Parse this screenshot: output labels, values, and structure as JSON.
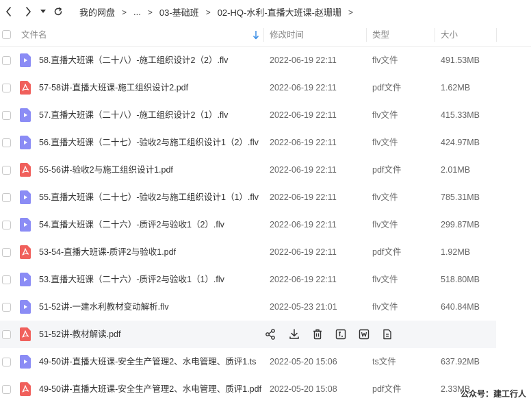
{
  "breadcrumb": {
    "items": [
      "我的网盘",
      "...",
      "03-基础班",
      "02-HQ-水利-直播大班课-赵珊珊"
    ],
    "separator": ">"
  },
  "columns": {
    "name": "文件名",
    "time": "修改时间",
    "type": "类型",
    "size": "大小"
  },
  "colors": {
    "video_icon": "#8b8cf5",
    "pdf_icon": "#f0605c",
    "sort_arrow": "#3a8ee6",
    "hover_row": "#f5f6f8"
  },
  "files": [
    {
      "icon": "video-file-icon",
      "name": "58.直播大班课（二十八）-施工组织设计2（2）.flv",
      "time": "2022-06-19 22:11",
      "type": "flv文件",
      "size": "491.53MB"
    },
    {
      "icon": "pdf-file-icon",
      "name": "57-58讲-直播大班课-施工组织设计2.pdf",
      "time": "2022-06-19 22:11",
      "type": "pdf文件",
      "size": "1.62MB"
    },
    {
      "icon": "video-file-icon",
      "name": "57.直播大班课（二十八）-施工组织设计2（1）.flv",
      "time": "2022-06-19 22:11",
      "type": "flv文件",
      "size": "415.33MB"
    },
    {
      "icon": "video-file-icon",
      "name": "56.直播大班课（二十七）-验收2与施工组织设计1（2）.flv",
      "time": "2022-06-19 22:11",
      "type": "flv文件",
      "size": "424.97MB"
    },
    {
      "icon": "pdf-file-icon",
      "name": "55-56讲-验收2与施工组织设计1.pdf",
      "time": "2022-06-19 22:11",
      "type": "pdf文件",
      "size": "2.01MB"
    },
    {
      "icon": "video-file-icon",
      "name": "55.直播大班课（二十七）-验收2与施工组织设计1（1）.flv",
      "time": "2022-06-19 22:11",
      "type": "flv文件",
      "size": "785.31MB"
    },
    {
      "icon": "video-file-icon",
      "name": "54.直播大班课（二十六）-质评2与验收1（2）.flv",
      "time": "2022-06-19 22:11",
      "type": "flv文件",
      "size": "299.87MB"
    },
    {
      "icon": "pdf-file-icon",
      "name": "53-54-直播大班课-质评2与验收1.pdf",
      "time": "2022-06-19 22:11",
      "type": "pdf文件",
      "size": "1.92MB"
    },
    {
      "icon": "video-file-icon",
      "name": "53.直播大班课（二十六）-质评2与验收1（1）.flv",
      "time": "2022-06-19 22:11",
      "type": "flv文件",
      "size": "518.80MB"
    },
    {
      "icon": "video-file-icon",
      "name": "51-52讲-一建水利教材变动解析.flv",
      "time": "2022-05-23 21:01",
      "type": "flv文件",
      "size": "640.84MB"
    },
    {
      "icon": "pdf-file-icon",
      "name": "51-52讲-教材解读.pdf",
      "time": "",
      "type": "",
      "size": "",
      "hovered": true,
      "actions": [
        "share-icon",
        "download-icon",
        "delete-icon",
        "text-extract-icon",
        "word-convert-icon",
        "more-file-icon"
      ]
    },
    {
      "icon": "video-file-icon",
      "name": "49-50讲-直播大班课-安全生产管理2、水电管理、质评1.ts",
      "time": "2022-05-20 15:06",
      "type": "ts文件",
      "size": "637.92MB"
    },
    {
      "icon": "pdf-file-icon",
      "name": "49-50讲-直播大班课-安全生产管理2、水电管理、质评1.pdf",
      "time": "2022-05-20 15:08",
      "type": "pdf文件",
      "size": "2.33MB"
    }
  ],
  "watermark": "公众号：建工行人"
}
